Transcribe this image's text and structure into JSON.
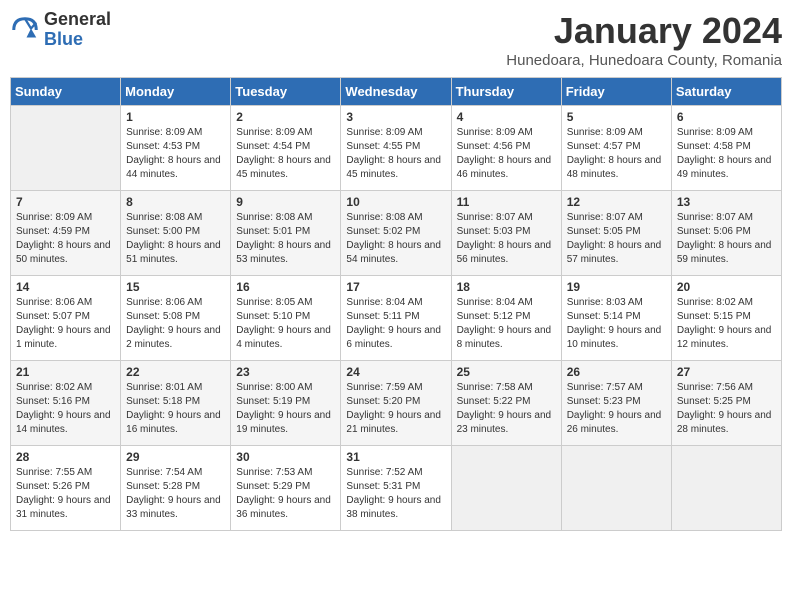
{
  "logo": {
    "general": "General",
    "blue": "Blue"
  },
  "title": "January 2024",
  "subtitle": "Hunedoara, Hunedoara County, Romania",
  "days_header": [
    "Sunday",
    "Monday",
    "Tuesday",
    "Wednesday",
    "Thursday",
    "Friday",
    "Saturday"
  ],
  "weeks": [
    [
      {
        "num": "",
        "empty": true
      },
      {
        "num": "1",
        "sunrise": "Sunrise: 8:09 AM",
        "sunset": "Sunset: 4:53 PM",
        "daylight": "Daylight: 8 hours and 44 minutes."
      },
      {
        "num": "2",
        "sunrise": "Sunrise: 8:09 AM",
        "sunset": "Sunset: 4:54 PM",
        "daylight": "Daylight: 8 hours and 45 minutes."
      },
      {
        "num": "3",
        "sunrise": "Sunrise: 8:09 AM",
        "sunset": "Sunset: 4:55 PM",
        "daylight": "Daylight: 8 hours and 45 minutes."
      },
      {
        "num": "4",
        "sunrise": "Sunrise: 8:09 AM",
        "sunset": "Sunset: 4:56 PM",
        "daylight": "Daylight: 8 hours and 46 minutes."
      },
      {
        "num": "5",
        "sunrise": "Sunrise: 8:09 AM",
        "sunset": "Sunset: 4:57 PM",
        "daylight": "Daylight: 8 hours and 48 minutes."
      },
      {
        "num": "6",
        "sunrise": "Sunrise: 8:09 AM",
        "sunset": "Sunset: 4:58 PM",
        "daylight": "Daylight: 8 hours and 49 minutes."
      }
    ],
    [
      {
        "num": "7",
        "sunrise": "Sunrise: 8:09 AM",
        "sunset": "Sunset: 4:59 PM",
        "daylight": "Daylight: 8 hours and 50 minutes."
      },
      {
        "num": "8",
        "sunrise": "Sunrise: 8:08 AM",
        "sunset": "Sunset: 5:00 PM",
        "daylight": "Daylight: 8 hours and 51 minutes."
      },
      {
        "num": "9",
        "sunrise": "Sunrise: 8:08 AM",
        "sunset": "Sunset: 5:01 PM",
        "daylight": "Daylight: 8 hours and 53 minutes."
      },
      {
        "num": "10",
        "sunrise": "Sunrise: 8:08 AM",
        "sunset": "Sunset: 5:02 PM",
        "daylight": "Daylight: 8 hours and 54 minutes."
      },
      {
        "num": "11",
        "sunrise": "Sunrise: 8:07 AM",
        "sunset": "Sunset: 5:03 PM",
        "daylight": "Daylight: 8 hours and 56 minutes."
      },
      {
        "num": "12",
        "sunrise": "Sunrise: 8:07 AM",
        "sunset": "Sunset: 5:05 PM",
        "daylight": "Daylight: 8 hours and 57 minutes."
      },
      {
        "num": "13",
        "sunrise": "Sunrise: 8:07 AM",
        "sunset": "Sunset: 5:06 PM",
        "daylight": "Daylight: 8 hours and 59 minutes."
      }
    ],
    [
      {
        "num": "14",
        "sunrise": "Sunrise: 8:06 AM",
        "sunset": "Sunset: 5:07 PM",
        "daylight": "Daylight: 9 hours and 1 minute."
      },
      {
        "num": "15",
        "sunrise": "Sunrise: 8:06 AM",
        "sunset": "Sunset: 5:08 PM",
        "daylight": "Daylight: 9 hours and 2 minutes."
      },
      {
        "num": "16",
        "sunrise": "Sunrise: 8:05 AM",
        "sunset": "Sunset: 5:10 PM",
        "daylight": "Daylight: 9 hours and 4 minutes."
      },
      {
        "num": "17",
        "sunrise": "Sunrise: 8:04 AM",
        "sunset": "Sunset: 5:11 PM",
        "daylight": "Daylight: 9 hours and 6 minutes."
      },
      {
        "num": "18",
        "sunrise": "Sunrise: 8:04 AM",
        "sunset": "Sunset: 5:12 PM",
        "daylight": "Daylight: 9 hours and 8 minutes."
      },
      {
        "num": "19",
        "sunrise": "Sunrise: 8:03 AM",
        "sunset": "Sunset: 5:14 PM",
        "daylight": "Daylight: 9 hours and 10 minutes."
      },
      {
        "num": "20",
        "sunrise": "Sunrise: 8:02 AM",
        "sunset": "Sunset: 5:15 PM",
        "daylight": "Daylight: 9 hours and 12 minutes."
      }
    ],
    [
      {
        "num": "21",
        "sunrise": "Sunrise: 8:02 AM",
        "sunset": "Sunset: 5:16 PM",
        "daylight": "Daylight: 9 hours and 14 minutes."
      },
      {
        "num": "22",
        "sunrise": "Sunrise: 8:01 AM",
        "sunset": "Sunset: 5:18 PM",
        "daylight": "Daylight: 9 hours and 16 minutes."
      },
      {
        "num": "23",
        "sunrise": "Sunrise: 8:00 AM",
        "sunset": "Sunset: 5:19 PM",
        "daylight": "Daylight: 9 hours and 19 minutes."
      },
      {
        "num": "24",
        "sunrise": "Sunrise: 7:59 AM",
        "sunset": "Sunset: 5:20 PM",
        "daylight": "Daylight: 9 hours and 21 minutes."
      },
      {
        "num": "25",
        "sunrise": "Sunrise: 7:58 AM",
        "sunset": "Sunset: 5:22 PM",
        "daylight": "Daylight: 9 hours and 23 minutes."
      },
      {
        "num": "26",
        "sunrise": "Sunrise: 7:57 AM",
        "sunset": "Sunset: 5:23 PM",
        "daylight": "Daylight: 9 hours and 26 minutes."
      },
      {
        "num": "27",
        "sunrise": "Sunrise: 7:56 AM",
        "sunset": "Sunset: 5:25 PM",
        "daylight": "Daylight: 9 hours and 28 minutes."
      }
    ],
    [
      {
        "num": "28",
        "sunrise": "Sunrise: 7:55 AM",
        "sunset": "Sunset: 5:26 PM",
        "daylight": "Daylight: 9 hours and 31 minutes."
      },
      {
        "num": "29",
        "sunrise": "Sunrise: 7:54 AM",
        "sunset": "Sunset: 5:28 PM",
        "daylight": "Daylight: 9 hours and 33 minutes."
      },
      {
        "num": "30",
        "sunrise": "Sunrise: 7:53 AM",
        "sunset": "Sunset: 5:29 PM",
        "daylight": "Daylight: 9 hours and 36 minutes."
      },
      {
        "num": "31",
        "sunrise": "Sunrise: 7:52 AM",
        "sunset": "Sunset: 5:31 PM",
        "daylight": "Daylight: 9 hours and 38 minutes."
      },
      {
        "num": "",
        "empty": true
      },
      {
        "num": "",
        "empty": true
      },
      {
        "num": "",
        "empty": true
      }
    ]
  ]
}
